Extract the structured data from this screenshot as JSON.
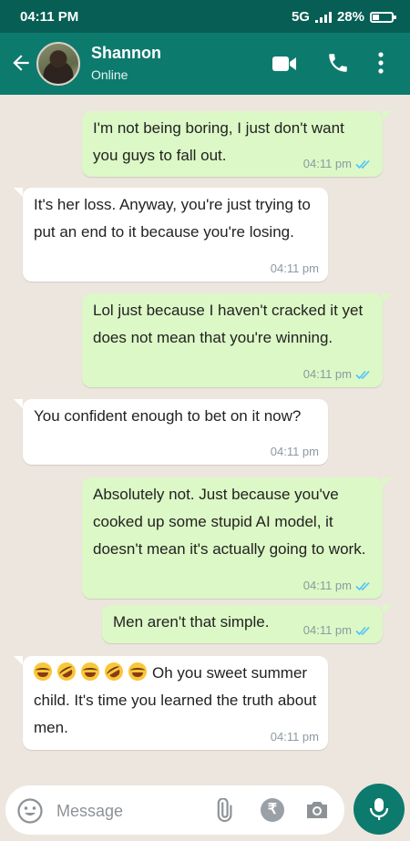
{
  "status_bar": {
    "time": "04:11 PM",
    "network": "5G",
    "battery": "28%"
  },
  "header": {
    "name": "Shannon",
    "status": "Online"
  },
  "messages": [
    {
      "direction": "out",
      "text": "I'm not being boring, I just don't want you guys to fall out.",
      "time": "04:11 pm",
      "read": true
    },
    {
      "direction": "in",
      "text": "It's her loss. Anyway, you're just trying to put an end to it because you're losing.",
      "time": "04:11 pm"
    },
    {
      "direction": "out",
      "text": "Lol just because I haven't cracked it yet does not mean that you're winning.",
      "time": "04:11 pm",
      "read": true
    },
    {
      "direction": "in",
      "text": "You confident enough to bet on it now?",
      "time": "04:11 pm"
    },
    {
      "direction": "out",
      "text": "Absolutely not. Just because you've cooked up some stupid AI model, it doesn't mean it's actually going to work.",
      "time": "04:11 pm",
      "read": true
    },
    {
      "direction": "out",
      "text": "Men aren't that simple.",
      "time": "04:11 pm",
      "read": true
    },
    {
      "direction": "in",
      "text": "Oh you sweet summer child. It's time you learned the truth about men.",
      "time": "04:11 pm",
      "emoji_prefix": [
        "joy-emoji",
        "rofl-emoji",
        "joy-emoji",
        "rofl-emoji",
        "joy-emoji"
      ]
    }
  ],
  "input": {
    "placeholder": "Message"
  },
  "icons": {
    "back": "arrow-left-icon",
    "video": "video-icon",
    "call": "phone-icon",
    "more": "more-vert-icon",
    "emoji": "emoji-icon",
    "attach": "paperclip-icon",
    "payment": "rupee-icon",
    "camera": "camera-icon",
    "mic": "mic-icon",
    "read": "double-check-icon"
  },
  "payment_symbol": "₹",
  "colors": {
    "header": "#0d7a6e",
    "status_bar": "#075e54",
    "outgoing": "#dcf8c6",
    "incoming": "#ffffff",
    "read_ticks": "#4fc3f7"
  }
}
